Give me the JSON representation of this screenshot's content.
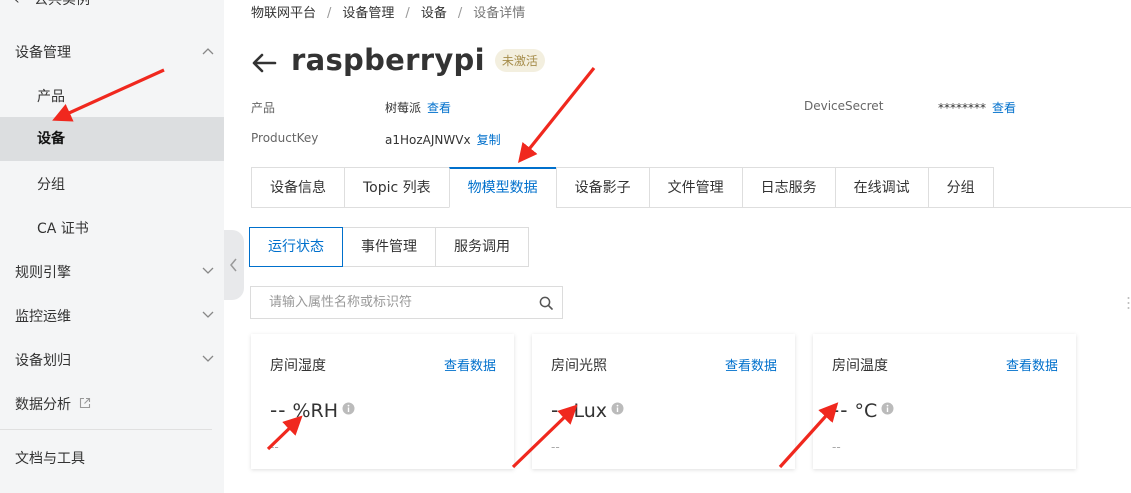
{
  "sidebar": {
    "top_label": "公共实例",
    "items": [
      {
        "label": "设备管理"
      },
      {
        "label": "产品"
      },
      {
        "label": "设备"
      },
      {
        "label": "分组"
      },
      {
        "label": "CA 证书"
      },
      {
        "label": "规则引擎"
      },
      {
        "label": "监控运维"
      },
      {
        "label": "设备划归"
      },
      {
        "label": "数据分析"
      },
      {
        "label": "文档与工具"
      }
    ]
  },
  "breadcrumb": [
    "物联网平台",
    "设备管理",
    "设备",
    "设备详情"
  ],
  "device": {
    "name": "raspberrypi",
    "status": "未激活",
    "product_label": "产品",
    "product_value": "树莓派",
    "view_link": "查看",
    "productkey_label": "ProductKey",
    "productkey_value": "a1HozAJNWVx",
    "copy_link": "复制",
    "secret_label": "DeviceSecret",
    "secret_value": "********",
    "secret_view_link": "查看"
  },
  "tabs": [
    "设备信息",
    "Topic 列表",
    "物模型数据",
    "设备影子",
    "文件管理",
    "日志服务",
    "在线调试",
    "分组"
  ],
  "active_tab": "物模型数据",
  "subtabs": [
    "运行状态",
    "事件管理",
    "服务调用"
  ],
  "search": {
    "placeholder": "请输入属性名称或标识符"
  },
  "cards": [
    {
      "title": "房间湿度",
      "link": "查看数据",
      "value": "--",
      "unit": "%RH",
      "sub": "--"
    },
    {
      "title": "房间光照",
      "link": "查看数据",
      "value": "--",
      "unit": "Lux",
      "sub": "--"
    },
    {
      "title": "房间温度",
      "link": "查看数据",
      "value": "--",
      "unit": "°C",
      "sub": "--"
    }
  ],
  "colors": {
    "accent": "#0070cc",
    "annotation_arrow": "#f0281e",
    "badge_bg": "#f3efdf"
  }
}
